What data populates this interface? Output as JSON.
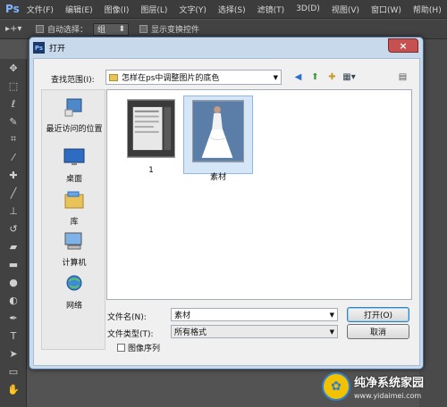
{
  "app": {
    "logo": "Ps",
    "menu": [
      "文件(F)",
      "编辑(E)",
      "图像(I)",
      "图层(L)",
      "文字(Y)",
      "选择(S)",
      "滤镜(T)",
      "3D(D)",
      "视图(V)",
      "窗口(W)",
      "帮助(H)"
    ]
  },
  "options_bar": {
    "auto_select_label": "自动选择：",
    "auto_select_value": "组",
    "show_transform_label": "显示变换控件"
  },
  "dialog": {
    "title": "打开",
    "close_label": "×",
    "look_in_label": "查找范围(I):",
    "look_in_value": "怎样在ps中调整图片的底色",
    "places": [
      {
        "label": "最近访问的位置",
        "icon": "recent-places-icon"
      },
      {
        "label": "桌面",
        "icon": "desktop-icon"
      },
      {
        "label": "库",
        "icon": "libraries-icon"
      },
      {
        "label": "计算机",
        "icon": "computer-icon"
      },
      {
        "label": "网络",
        "icon": "network-icon"
      }
    ],
    "files": [
      {
        "name": "1",
        "selected": false
      },
      {
        "name": "素材",
        "selected": true
      }
    ],
    "filename_label": "文件名(N):",
    "filename_value": "素材",
    "filetype_label": "文件类型(T):",
    "filetype_value": "所有格式",
    "open_button": "打开(O)",
    "cancel_button": "取消",
    "image_sequence_label": "图像序列"
  },
  "watermark": {
    "title": "纯净系统家园",
    "url": "www.yidaimei.com"
  },
  "colors": {
    "ps_blue": "#7fb6ff",
    "selection": "#d5e6f8",
    "dialog_frame": "#c9d9ec"
  }
}
